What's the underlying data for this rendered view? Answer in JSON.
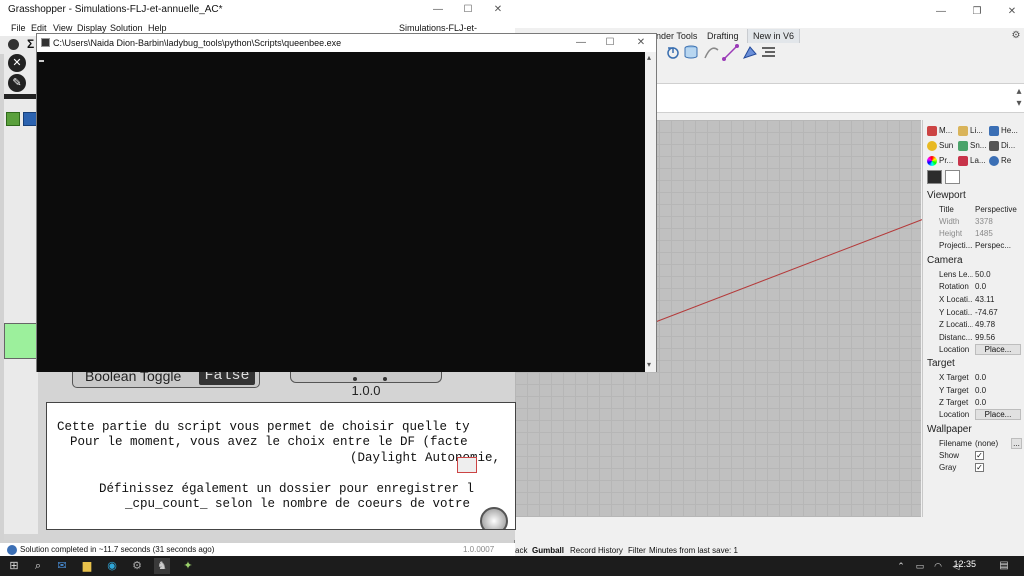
{
  "grasshopper": {
    "title": "Grasshopper - Simulations-FLJ-et-annuelle_AC*",
    "document_name": "Simulations-FLJ-et-annuelle_AC",
    "menu": [
      "File",
      "Edit",
      "View",
      "Display",
      "Solution",
      "Help"
    ],
    "boolean_toggle": {
      "label": "Boolean Toggle",
      "value": "False"
    },
    "version_value": "1.0.0",
    "panel_lines": [
      "Cette partie du script vous permet de choisir quelle ty",
      "Pour le moment, vous avez le choix entre le DF (facte",
      "(Daylight Autonomie,",
      "",
      "Définissez également un dossier pour enregistrer l",
      "_cpu_count_ selon le nombre de coeurs de votre"
    ],
    "status": "Solution completed in ~11.7 seconds (31 seconds ago)",
    "version": "1.0.0007"
  },
  "console": {
    "title": "C:\\Users\\Naida Dion-Barbin\\ladybug_tools\\python\\Scripts\\queenbee.exe"
  },
  "rhino": {
    "tabs": [
      "nder Tools",
      "Drafting",
      "New in V6"
    ],
    "status_items": [
      "ack",
      "Gumball",
      "Record History",
      "Filter",
      "Minutes from last save: 1"
    ],
    "properties": {
      "tabs_row1": [
        "M...",
        "Li...",
        "He..."
      ],
      "tabs_row2": [
        "Sun",
        "Sn...",
        "Di..."
      ],
      "tabs_row3": [
        "Pr...",
        "La...",
        "Re"
      ],
      "viewport": {
        "header": "Viewport",
        "rows": [
          {
            "k": "Title",
            "v": "Perspective"
          },
          {
            "k": "Width",
            "v": "3378"
          },
          {
            "k": "Height",
            "v": "1485"
          },
          {
            "k": "Projecti...",
            "v": "Perspec..."
          }
        ]
      },
      "camera": {
        "header": "Camera",
        "rows": [
          {
            "k": "Lens Le...",
            "v": "50.0"
          },
          {
            "k": "Rotation",
            "v": "0.0"
          },
          {
            "k": "X Locati...",
            "v": "43.11"
          },
          {
            "k": "Y Locati...",
            "v": "-74.67"
          },
          {
            "k": "Z Locati...",
            "v": "49.78"
          },
          {
            "k": "Distanc...",
            "v": "99.56"
          },
          {
            "k": "Location",
            "v": "Place..."
          }
        ]
      },
      "target": {
        "header": "Target",
        "rows": [
          {
            "k": "X Target",
            "v": "0.0"
          },
          {
            "k": "Y Target",
            "v": "0.0"
          },
          {
            "k": "Z Target",
            "v": "0.0"
          },
          {
            "k": "Location",
            "v": "Place..."
          }
        ]
      },
      "wallpaper": {
        "header": "Wallpaper",
        "rows": [
          {
            "k": "Filename",
            "v": "(none)"
          },
          {
            "k": "Show",
            "v": "✓"
          },
          {
            "k": "Gray",
            "v": "✓"
          }
        ],
        "browse": "..."
      }
    }
  },
  "taskbar": {
    "time": "12:35",
    "icons": [
      "windows-start-icon",
      "search-icon",
      "mail-icon",
      "file-explorer-icon",
      "edge-icon",
      "settings-icon",
      "rhino-icon",
      "grasshopper-icon"
    ]
  },
  "colors": {
    "console_bg": "#0c0c0c",
    "toggle_value_bg": "#333333",
    "component_green": "#9cf09c",
    "taskbar_bg": "#1c1c1c"
  }
}
